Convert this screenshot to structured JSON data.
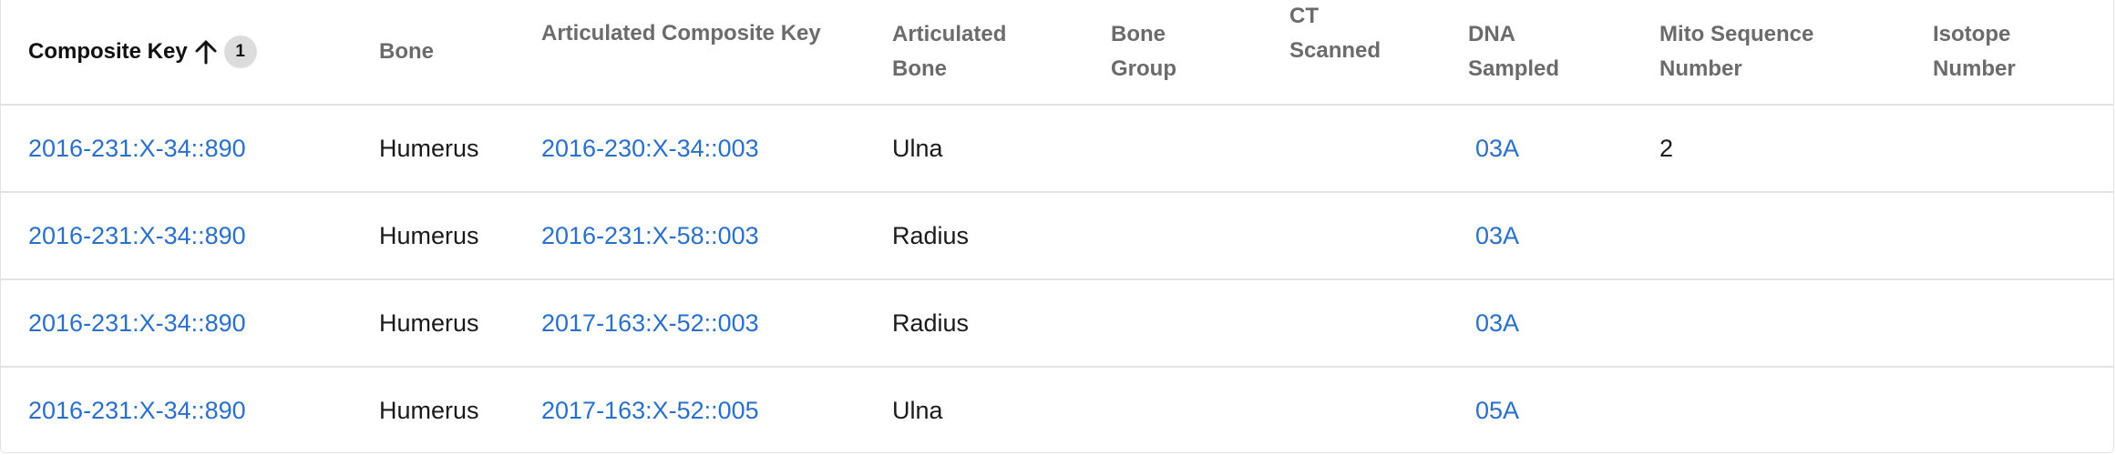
{
  "columns": [
    {
      "key": "composite_key",
      "label": "Composite Key"
    },
    {
      "key": "bone",
      "label": "Bone"
    },
    {
      "key": "articulated_composite_key",
      "label": "Articulated Composite Key"
    },
    {
      "key": "articulated_bone",
      "label": "Articulated Bone"
    },
    {
      "key": "bone_group",
      "label": "Bone Group"
    },
    {
      "key": "ct_scanned",
      "label": "CT Scanned"
    },
    {
      "key": "dna_sampled",
      "label": "DNA Sampled"
    },
    {
      "key": "mito_sequence_number",
      "label": "Mito Sequence Number"
    },
    {
      "key": "isotope_number",
      "label": "Isotope Number"
    }
  ],
  "sort": {
    "column": "composite_key",
    "direction": "ascending",
    "icon": "arrow-up-icon",
    "priority": "1"
  },
  "rows": [
    {
      "composite_key": "2016-231:X-34::890",
      "bone": "Humerus",
      "articulated_composite_key": "2016-230:X-34::003",
      "articulated_bone": "Ulna",
      "bone_group": "",
      "ct_scanned": "",
      "dna_sampled": "03A",
      "mito_sequence_number": "2",
      "isotope_number": ""
    },
    {
      "composite_key": "2016-231:X-34::890",
      "bone": "Humerus",
      "articulated_composite_key": "2016-231:X-58::003",
      "articulated_bone": "Radius",
      "bone_group": "",
      "ct_scanned": "",
      "dna_sampled": "03A",
      "mito_sequence_number": "",
      "isotope_number": ""
    },
    {
      "composite_key": "2016-231:X-34::890",
      "bone": "Humerus",
      "articulated_composite_key": "2017-163:X-52::003",
      "articulated_bone": "Radius",
      "bone_group": "",
      "ct_scanned": "",
      "dna_sampled": "03A",
      "mito_sequence_number": "",
      "isotope_number": ""
    },
    {
      "composite_key": "2016-231:X-34::890",
      "bone": "Humerus",
      "articulated_composite_key": "2017-163:X-52::005",
      "articulated_bone": "Ulna",
      "bone_group": "",
      "ct_scanned": "",
      "dna_sampled": "05A",
      "mito_sequence_number": "",
      "isotope_number": ""
    }
  ],
  "colors": {
    "link": "#2a6fc9",
    "header_text": "#6b6b6b",
    "active_header_text": "#111111",
    "badge_bg": "#dcdcdc",
    "row_border": "#e3e3e3"
  }
}
